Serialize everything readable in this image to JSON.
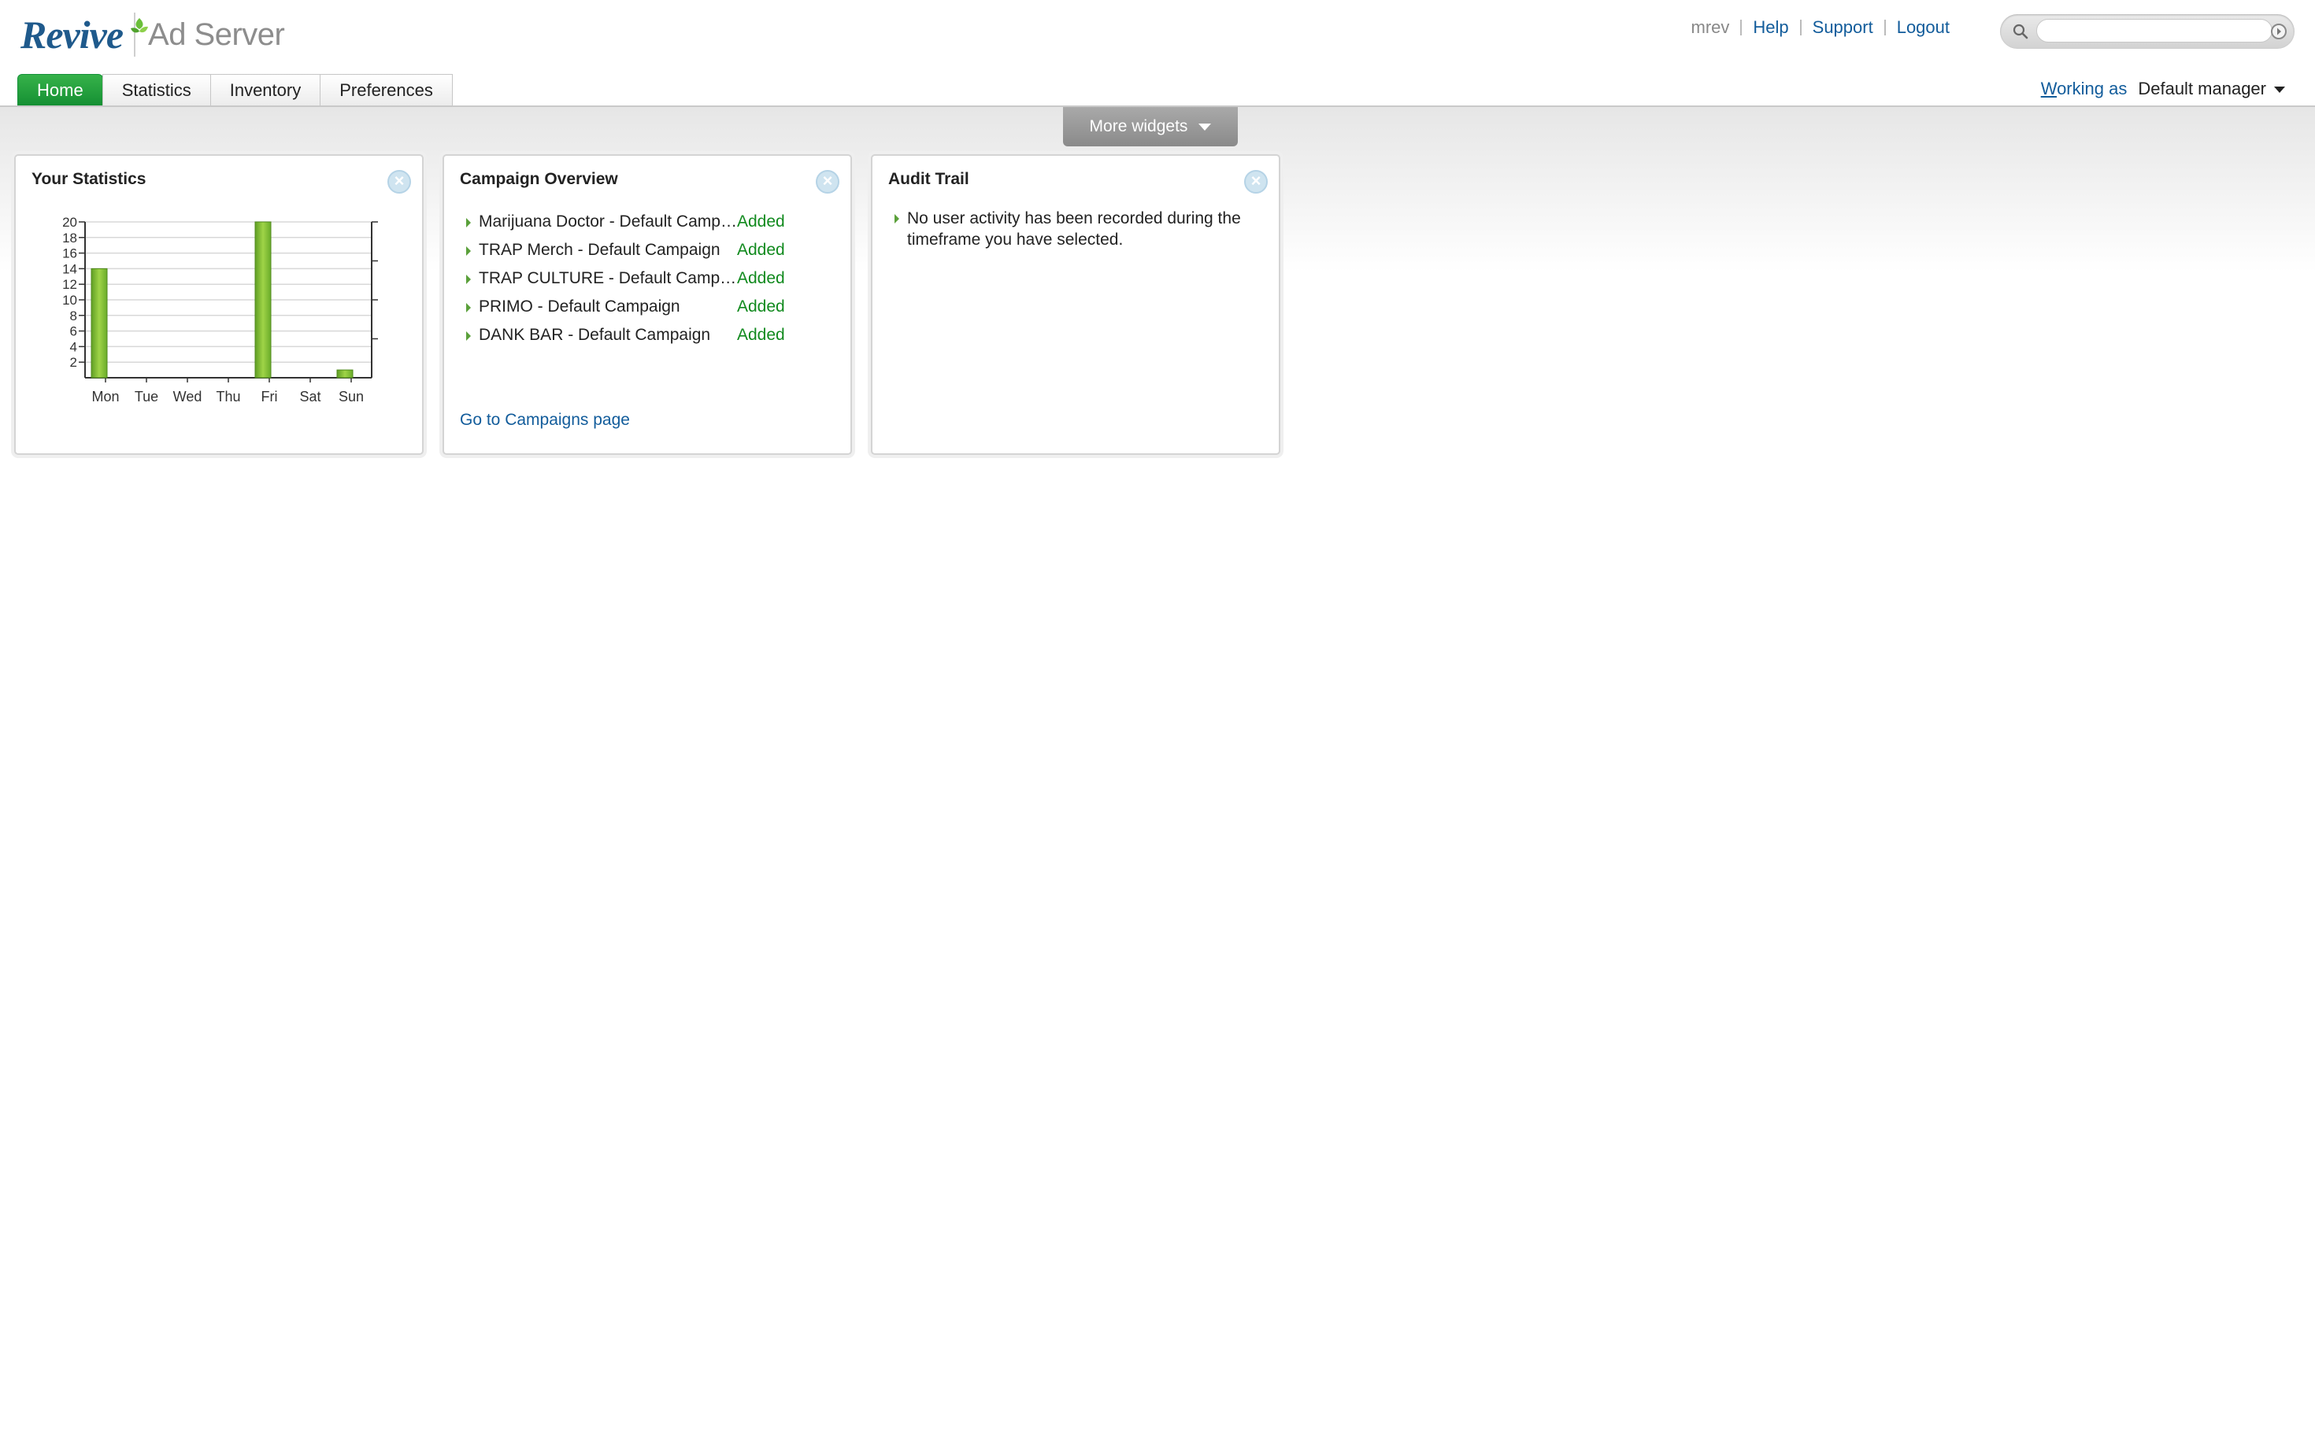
{
  "brand": {
    "logo_text": "Revive",
    "product": "Ad Server"
  },
  "toplinks": {
    "username": "mrev",
    "help": "Help",
    "support": "Support",
    "logout": "Logout"
  },
  "search": {
    "value": ""
  },
  "tabs": [
    {
      "label": "Home",
      "active": true
    },
    {
      "label": "Statistics",
      "active": false
    },
    {
      "label": "Inventory",
      "active": false
    },
    {
      "label": "Preferences",
      "active": false
    }
  ],
  "working_as": {
    "label": "Working as",
    "value": "Default manager"
  },
  "more_widgets": {
    "label": "More widgets"
  },
  "widgets": {
    "stats": {
      "title": "Your Statistics"
    },
    "campaigns": {
      "title": "Campaign Overview",
      "items": [
        {
          "name": "Marijuana Doctor - Default Campaign",
          "status": "Added"
        },
        {
          "name": "TRAP Merch - Default Campaign",
          "status": "Added"
        },
        {
          "name": "TRAP CULTURE - Default Campaign",
          "status": "Added"
        },
        {
          "name": "PRIMO - Default Campaign",
          "status": "Added"
        },
        {
          "name": "DANK BAR - Default Campaign",
          "status": "Added"
        }
      ],
      "link": "Go to Campaigns page"
    },
    "audit": {
      "title": "Audit Trail",
      "message": "No user activity has been recorded during the timeframe you have selected."
    }
  },
  "colors": {
    "active_tab": "#159033",
    "link": "#125c9b",
    "status_added": "#118a1e",
    "bar": "#7fbf2f"
  },
  "icons": {
    "search": "magnifier-icon",
    "search_go": "arrow-circle-icon",
    "close": "close-circle-icon",
    "caret": "caret-down-icon",
    "row": "triangle-right-icon"
  },
  "chart_data": {
    "type": "bar",
    "categories": [
      "Mon",
      "Tue",
      "Wed",
      "Thu",
      "Fri",
      "Sat",
      "Sun"
    ],
    "values": [
      14,
      0,
      0,
      0,
      20,
      0,
      1
    ],
    "ylim": [
      0,
      20
    ],
    "yticks": [
      "2",
      "4",
      "6",
      "8",
      "10",
      "12",
      "14",
      "16",
      "18",
      "20"
    ],
    "y2lim": [
      0,
      1
    ],
    "y2ticks": [
      "0.25",
      "0.50",
      "0.75",
      "1"
    ],
    "grid": true
  }
}
